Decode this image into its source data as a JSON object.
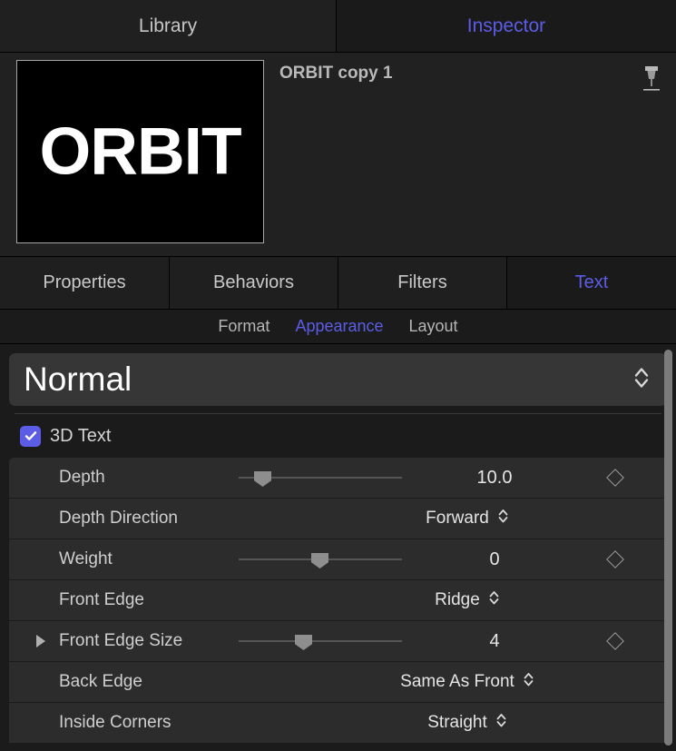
{
  "top_tabs": [
    {
      "label": "Library",
      "selected": false
    },
    {
      "label": "Inspector",
      "selected": true
    }
  ],
  "header": {
    "clip_title": "ORBIT copy 1",
    "thumbnail_text": "ORBIT",
    "pin_icon": "pin-icon"
  },
  "section_tabs": [
    {
      "label": "Properties",
      "selected": false
    },
    {
      "label": "Behaviors",
      "selected": false
    },
    {
      "label": "Filters",
      "selected": false
    },
    {
      "label": "Text",
      "selected": true
    }
  ],
  "sub_tabs": [
    {
      "label": "Format",
      "selected": false
    },
    {
      "label": "Appearance",
      "selected": true
    },
    {
      "label": "Layout",
      "selected": false
    }
  ],
  "style_popup": {
    "value": "Normal",
    "chevron_icon": "chevron-up-down-icon"
  },
  "three_d_text": {
    "label": "3D Text",
    "checked": true
  },
  "rows": [
    {
      "label": "Depth",
      "type": "slider",
      "value": "10.0",
      "knob_percent": 9,
      "keyframe": true,
      "disclosure": false
    },
    {
      "label": "Depth Direction",
      "type": "popup",
      "value": "Forward",
      "keyframe": false,
      "disclosure": false
    },
    {
      "label": "Weight",
      "type": "slider",
      "value": "0",
      "knob_percent": 47,
      "keyframe": true,
      "disclosure": false
    },
    {
      "label": "Front Edge",
      "type": "popup",
      "value": "Ridge",
      "keyframe": false,
      "disclosure": false
    },
    {
      "label": "Front Edge Size",
      "type": "slider",
      "value": "4",
      "knob_percent": 37,
      "keyframe": true,
      "disclosure": true
    },
    {
      "label": "Back Edge",
      "type": "popup",
      "value": "Same As Front",
      "keyframe": false,
      "disclosure": false
    },
    {
      "label": "Inside Corners",
      "type": "popup",
      "value": "Straight",
      "keyframe": false,
      "disclosure": false
    }
  ],
  "colors": {
    "accent": "#5c5ce6",
    "panel_bg": "#1b1b1b",
    "row_bg": "#2c2c2c",
    "text": "#cfcfcf"
  }
}
